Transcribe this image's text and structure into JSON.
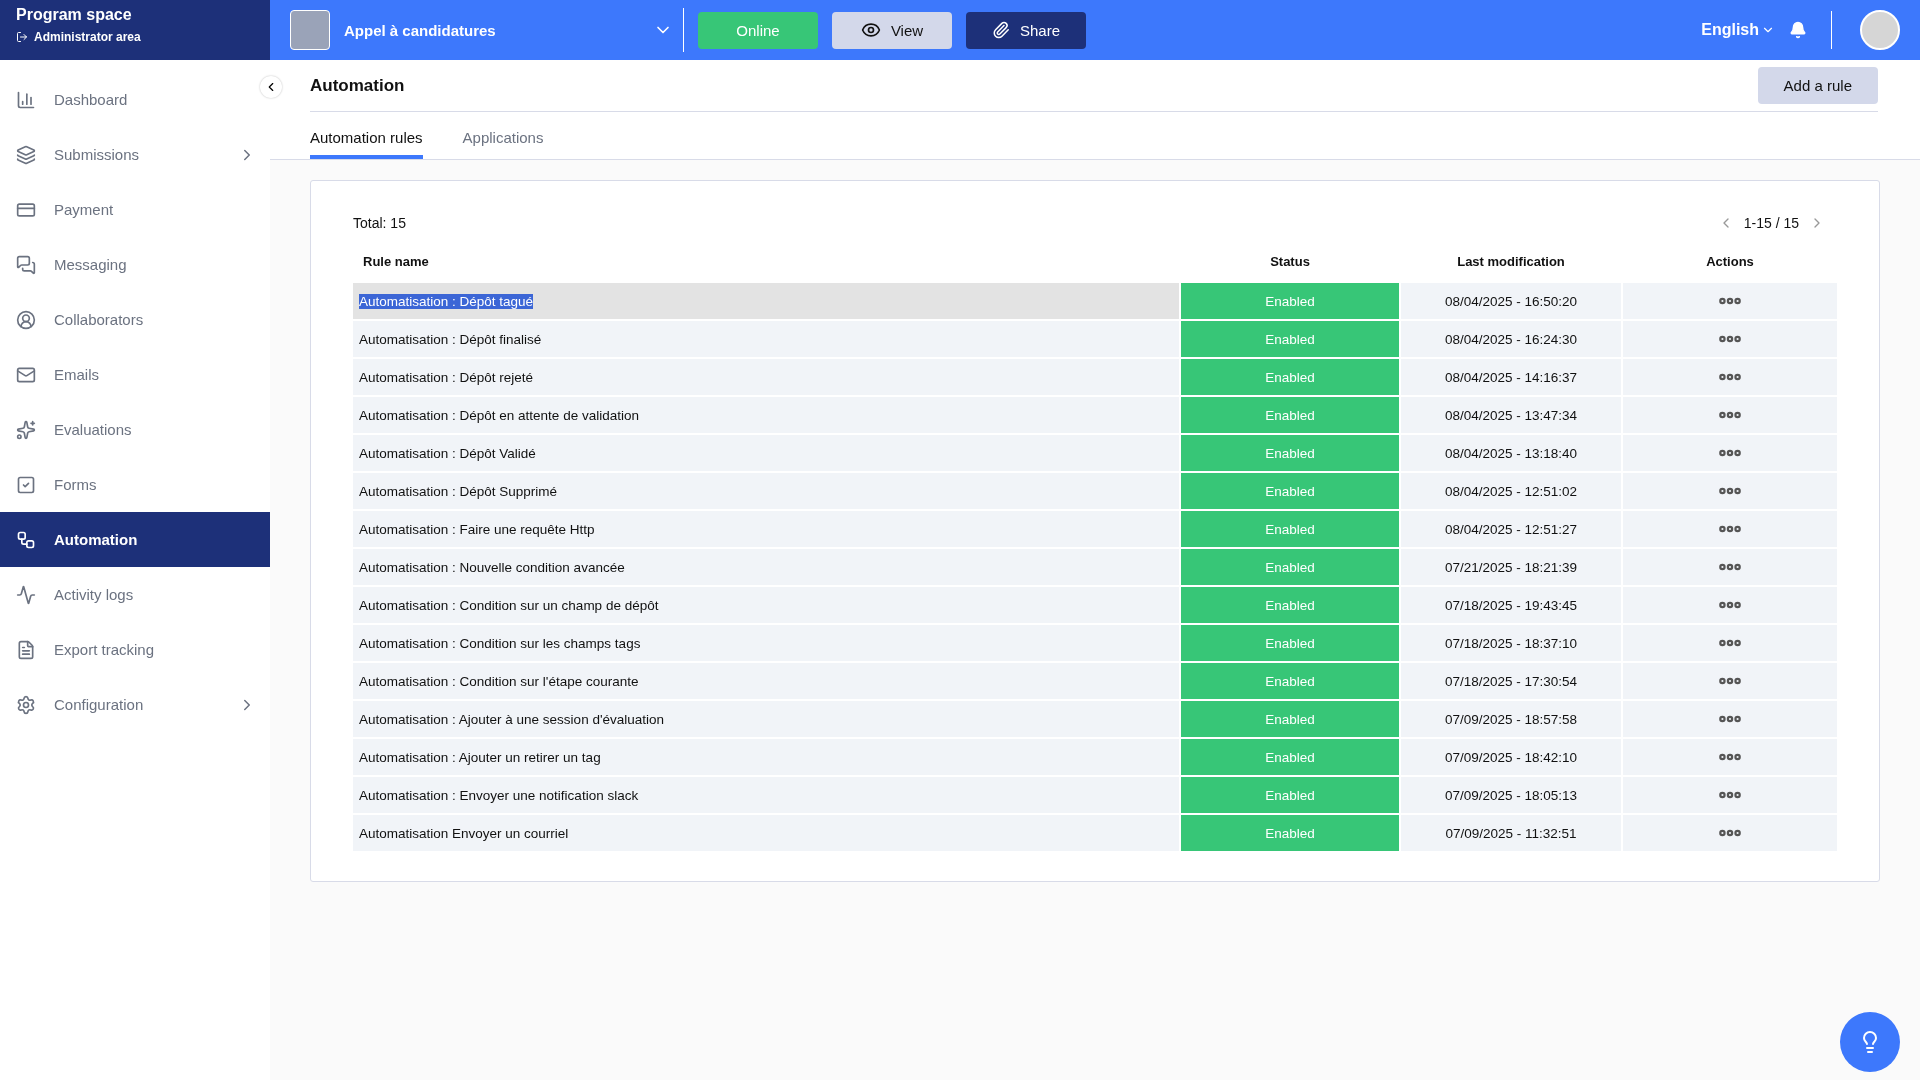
{
  "sidebar": {
    "title": "Program space",
    "subtitle": "Administrator area",
    "items": [
      {
        "label": "Dashboard",
        "selected": false,
        "has_submenu": false
      },
      {
        "label": "Submissions",
        "selected": false,
        "has_submenu": true
      },
      {
        "label": "Payment",
        "selected": false,
        "has_submenu": false
      },
      {
        "label": "Messaging",
        "selected": false,
        "has_submenu": false
      },
      {
        "label": "Collaborators",
        "selected": false,
        "has_submenu": false
      },
      {
        "label": "Emails",
        "selected": false,
        "has_submenu": false
      },
      {
        "label": "Evaluations",
        "selected": false,
        "has_submenu": false
      },
      {
        "label": "Forms",
        "selected": false,
        "has_submenu": false
      },
      {
        "label": "Automation",
        "selected": true,
        "has_submenu": false
      },
      {
        "label": "Activity logs",
        "selected": false,
        "has_submenu": false
      },
      {
        "label": "Export tracking",
        "selected": false,
        "has_submenu": false
      },
      {
        "label": "Configuration",
        "selected": false,
        "has_submenu": true
      }
    ]
  },
  "topbar": {
    "program": "Appel à candidatures",
    "status_button": "Online",
    "view_button": "View",
    "share_button": "Share",
    "language": "English"
  },
  "page": {
    "title": "Automation",
    "add_button": "Add a rule",
    "tabs": [
      {
        "label": "Automation rules",
        "selected": true
      },
      {
        "label": "Applications",
        "selected": false
      }
    ]
  },
  "table": {
    "total": "Total: 15",
    "pagination": "1-15 / 15",
    "columns": [
      "Rule name",
      "Status",
      "Last modification",
      "Actions"
    ],
    "rows": [
      {
        "name": "Automatisation : Dépôt tagué",
        "status": "Enabled",
        "modified": "08/04/2025 - 16:50:20",
        "selected": true
      },
      {
        "name": "Automatisation : Dépôt finalisé",
        "status": "Enabled",
        "modified": "08/04/2025 - 16:24:30",
        "selected": false
      },
      {
        "name": "Automatisation : Dépôt rejeté",
        "status": "Enabled",
        "modified": "08/04/2025 - 14:16:37",
        "selected": false
      },
      {
        "name": "Automatisation : Dépôt en attente de validation",
        "status": "Enabled",
        "modified": "08/04/2025 - 13:47:34",
        "selected": false
      },
      {
        "name": "Automatisation : Dépôt Validé",
        "status": "Enabled",
        "modified": "08/04/2025 - 13:18:40",
        "selected": false
      },
      {
        "name": "Automatisation : Dépôt Supprimé",
        "status": "Enabled",
        "modified": "08/04/2025 - 12:51:02",
        "selected": false
      },
      {
        "name": "Automatisation : Faire une requête Http",
        "status": "Enabled",
        "modified": "08/04/2025 - 12:51:27",
        "selected": false
      },
      {
        "name": "Automatisation : Nouvelle condition avancée",
        "status": "Enabled",
        "modified": "07/21/2025 - 18:21:39",
        "selected": false
      },
      {
        "name": "Automatisation : Condition sur un champ de dépôt",
        "status": "Enabled",
        "modified": "07/18/2025 - 19:43:45",
        "selected": false
      },
      {
        "name": "Automatisation : Condition sur les champs tags",
        "status": "Enabled",
        "modified": "07/18/2025 - 18:37:10",
        "selected": false
      },
      {
        "name": "Automatisation : Condition sur l'étape courante",
        "status": "Enabled",
        "modified": "07/18/2025 - 17:30:54",
        "selected": false
      },
      {
        "name": "Automatisation : Ajouter à une session d'évaluation",
        "status": "Enabled",
        "modified": "07/09/2025 - 18:57:58",
        "selected": false
      },
      {
        "name": "Automatisation : Ajouter un retirer un tag",
        "status": "Enabled",
        "modified": "07/09/2025 - 18:42:10",
        "selected": false
      },
      {
        "name": "Automatisation : Envoyer une notification slack",
        "status": "Enabled",
        "modified": "07/09/2025 - 18:05:13",
        "selected": false
      },
      {
        "name": "Automatisation Envoyer un courriel",
        "status": "Enabled",
        "modified": "07/09/2025 - 11:32:51",
        "selected": false
      }
    ]
  }
}
